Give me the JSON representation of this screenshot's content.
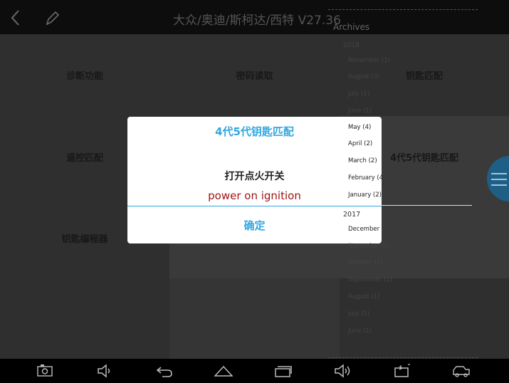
{
  "header": {
    "title": "大众/奥迪/斯柯达/西特 V27.36"
  },
  "grid": {
    "cells": [
      "诊断功能",
      "密码读取",
      "钥匙匹配",
      "遥控匹配",
      "",
      "4代5代钥匙匹配",
      "钥匙编程器",
      "",
      ""
    ]
  },
  "archives": {
    "title": "Archives",
    "year_2018": "2018",
    "months_2018": [
      "November (1)",
      "August (3)",
      "July (1)",
      "June (1)",
      "May (4)",
      "April (2)",
      "March (2)",
      "February (4",
      "January (2)"
    ],
    "year_2017": "2017",
    "months_2017": [
      "December",
      "November (1)",
      "October (1)",
      "September (1)",
      "August (1)",
      "July (1)",
      "June (1)"
    ]
  },
  "dialog": {
    "title": "4代5代钥匙匹配",
    "message": "打开点火开关",
    "message_en": "power on ignition",
    "ok_label": "确定"
  },
  "bottom_nav": {
    "icons": [
      "screenshot-icon",
      "volume-down-icon",
      "back-icon",
      "home-icon",
      "recents-icon",
      "volume-up-icon",
      "battery-icon",
      "vehicle-icon"
    ]
  },
  "colors": {
    "accent": "#33a7e0",
    "warning_text": "#a11414"
  }
}
